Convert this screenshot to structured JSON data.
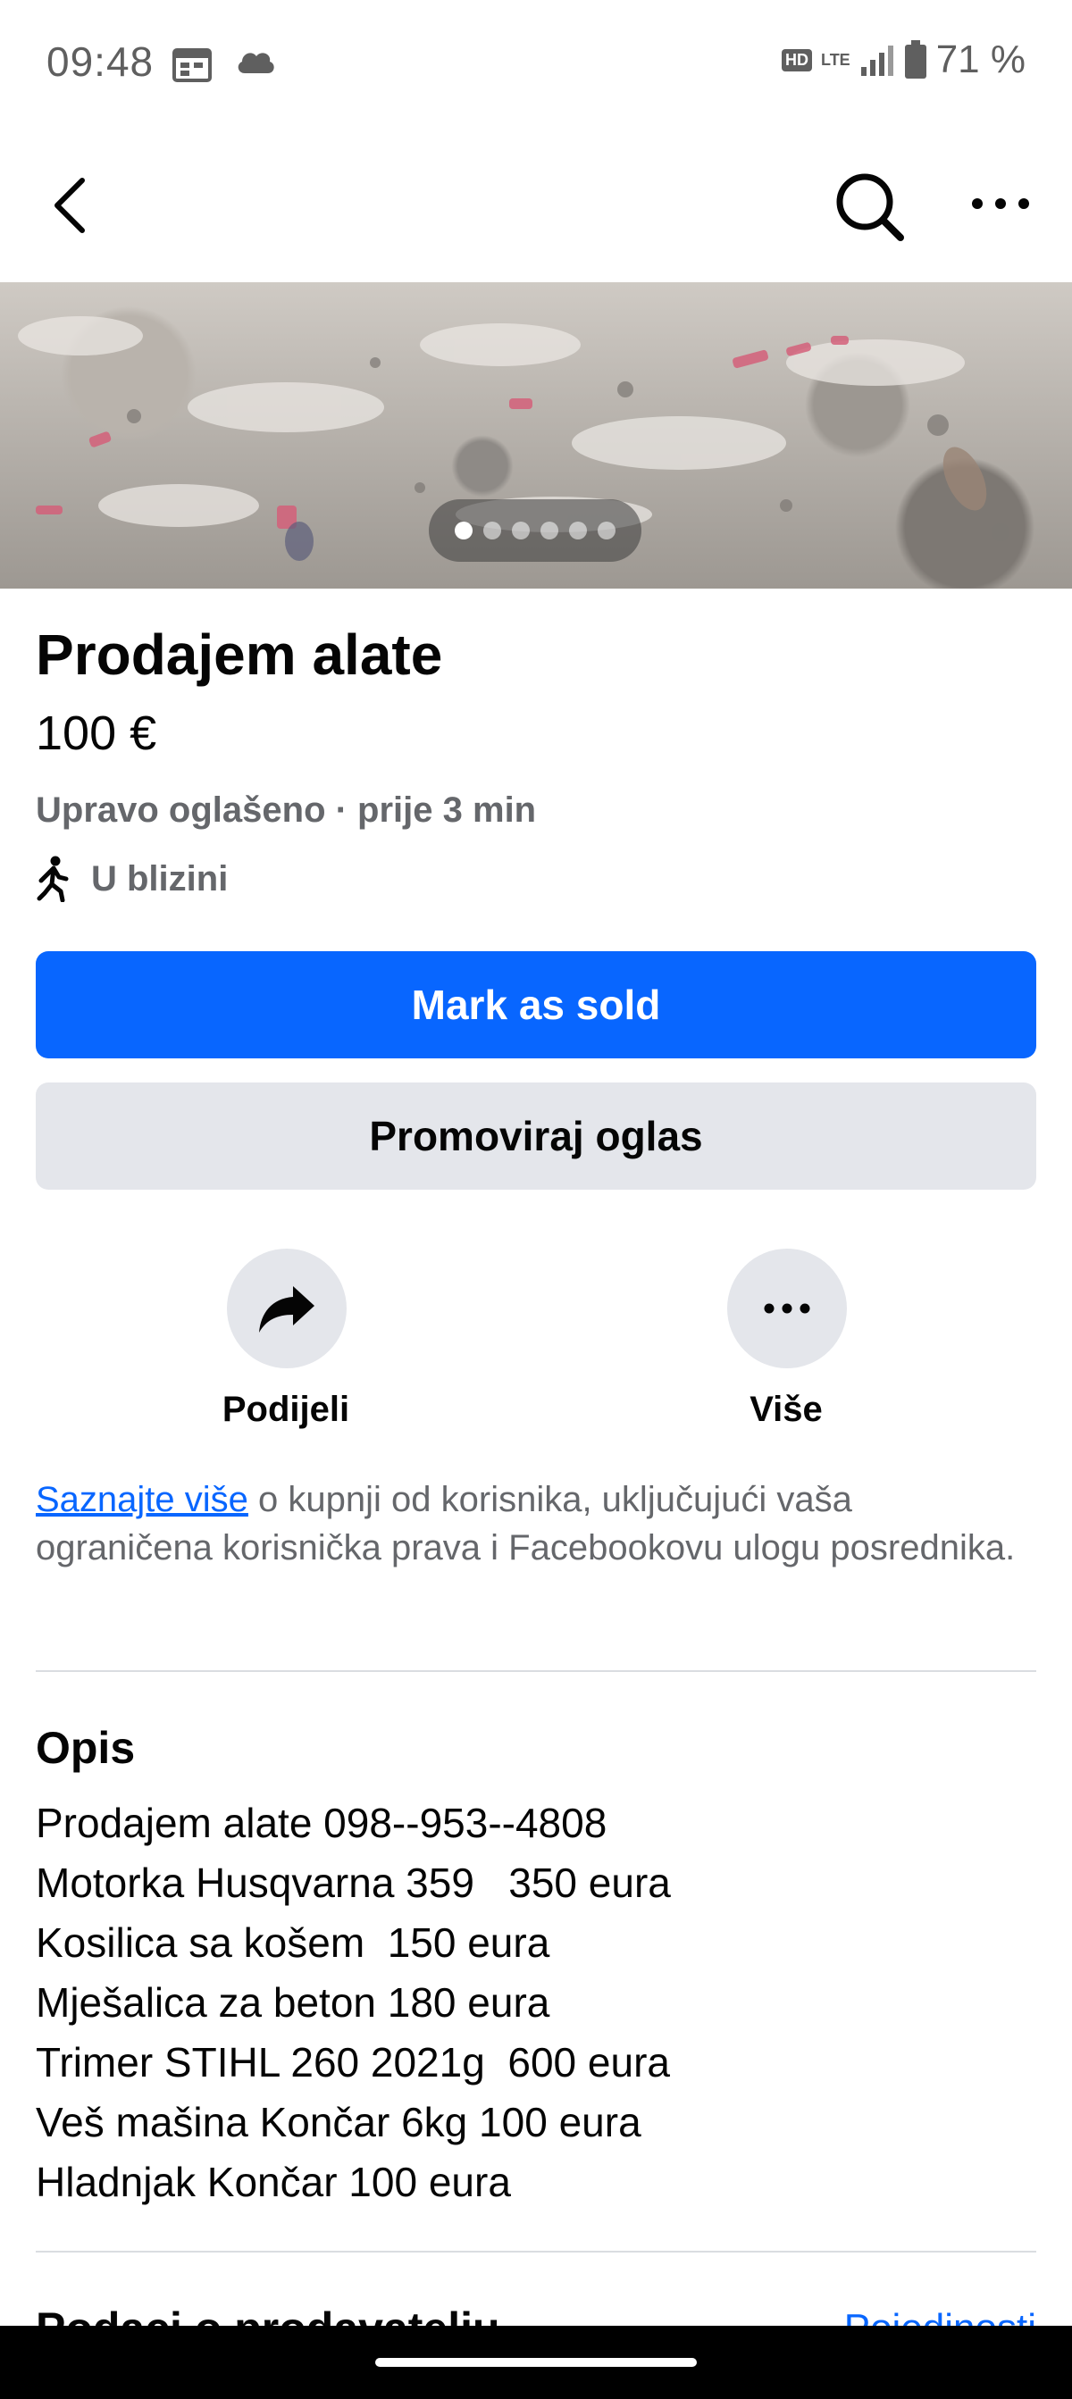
{
  "status_bar": {
    "time": "09:48",
    "hd_label": "HD",
    "network_label": "LTE",
    "battery": "71 %"
  },
  "nav": {
    "back_icon": "chevron-left-icon",
    "search_icon": "search-icon",
    "more_icon": "more-horizontal-icon"
  },
  "gallery": {
    "image_count": 6,
    "active_index": 0
  },
  "listing": {
    "title": "Prodajem alate",
    "price": "100 €",
    "meta": "Upravo oglašeno · prije 3 min",
    "location": "U blizini"
  },
  "buttons": {
    "mark_sold": "Mark as sold",
    "promote": "Promoviraj oglas"
  },
  "actions": {
    "share": "Podijeli",
    "more": "Više"
  },
  "legal": {
    "link": "Saznajte više",
    "text": " o kupnji od korisnika, uključujući vaša ograničena korisnička prava i Facebookovu ulogu posrednika."
  },
  "description": {
    "title": "Opis",
    "lines": [
      "Prodajem alate 098--953--4808",
      "Motorka Husqvarna 359   350 eura",
      "Kosilica sa košem  150 eura",
      "Mješalica za beton 180 eura",
      "Trimer STIHL 260 2021g  600 eura",
      "Veš mašina Končar 6kg 100 eura",
      "Hladnjak Končar 100 eura"
    ]
  },
  "seller": {
    "title": "Podaci o prodavatelju",
    "link": "Pojedinosti"
  },
  "colors": {
    "primary": "#0866ff",
    "secondary_bg": "#e4e6eb",
    "muted_text": "#65676b"
  }
}
